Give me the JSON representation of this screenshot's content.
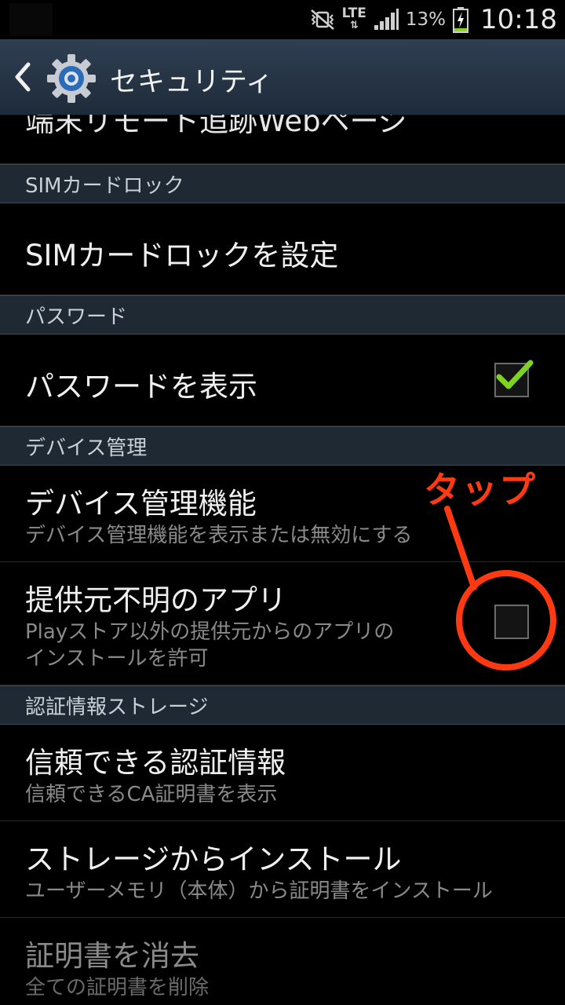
{
  "status_bar": {
    "network": "LTE",
    "battery_percent": "13%",
    "time": "10:18",
    "icons": [
      "mute-vibrate-icon",
      "lte-icon",
      "signal-icon",
      "battery-charging-icon"
    ]
  },
  "action_bar": {
    "title": "セキュリティ",
    "icons": [
      "back-icon",
      "settings-gear-icon"
    ]
  },
  "list": {
    "cut_item": "端末リモート追跡Webページ",
    "sections": [
      {
        "header": "SIMカードロック",
        "items": [
          {
            "title": "SIMカードロックを設定"
          }
        ]
      },
      {
        "header": "パスワード",
        "items": [
          {
            "title": "パスワードを表示",
            "checked": true
          }
        ]
      },
      {
        "header": "デバイス管理",
        "items": [
          {
            "title": "デバイス管理機能",
            "subtitle": "デバイス管理機能を表示または無効にする"
          },
          {
            "title": "提供元不明のアプリ",
            "subtitle_line1": "Playストア以外の提供元からのアプリの",
            "subtitle_line2": "インストールを許可",
            "checked": false
          }
        ]
      },
      {
        "header": "認証情報ストレージ",
        "items": [
          {
            "title": "信頼できる認証情報",
            "subtitle": "信頼できるCA証明書を表示"
          },
          {
            "title": "ストレージからインストール",
            "subtitle": "ユーザーメモリ（本体）から証明書をインストール"
          },
          {
            "title": "証明書を消去",
            "subtitle": "全ての証明書を削除",
            "disabled": true
          }
        ]
      }
    ]
  },
  "annotation": {
    "label": "タップ",
    "color": "#ff3a12"
  },
  "colors": {
    "accent_check": "#7ed321",
    "header_bg": "#1f2934",
    "actionbar_bg": "#2f3f52"
  }
}
